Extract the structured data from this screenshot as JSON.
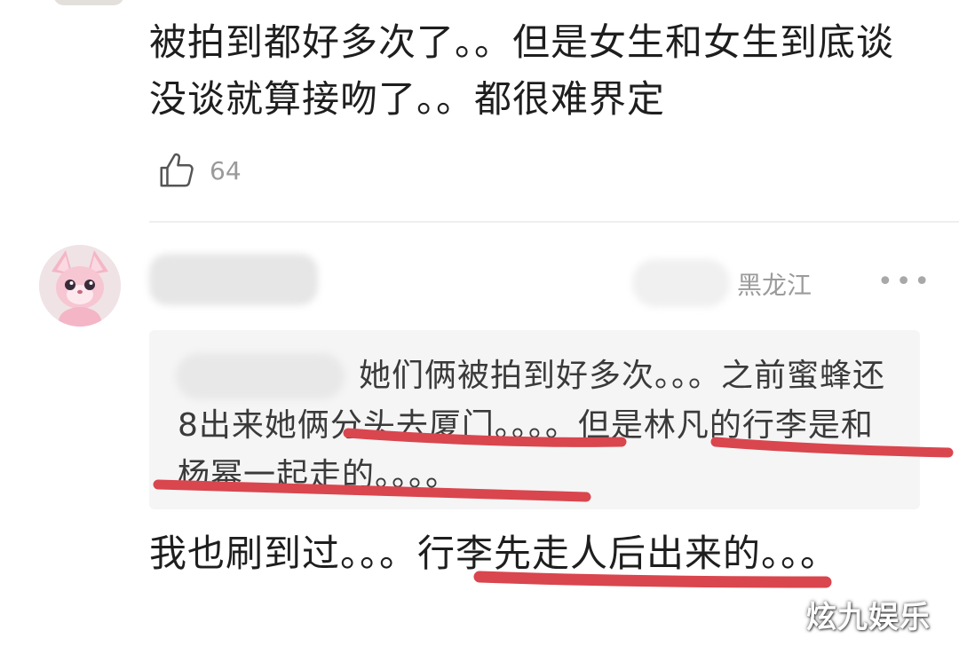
{
  "comment1": {
    "text": "被拍到都好多次了。。但是女生和女生到底谈没谈就算接吻了。。都很难界定",
    "likes": "64"
  },
  "comment2": {
    "location": "黑龙江",
    "more_icon": "more-dots-icon",
    "quote": "她们俩被拍到好多次。。。之前蜜蜂还8出来她俩分头去厦门。。。。但是林凡的行李是和杨幂一起走的。。。。",
    "reply": "我也刷到过。。。行李先走人后出来的。。。"
  },
  "watermark": "炫九娱乐",
  "colors": {
    "underline": "#d9464e",
    "quote_bg": "#f5f5f5",
    "meta_gray": "#9b9b9b"
  }
}
